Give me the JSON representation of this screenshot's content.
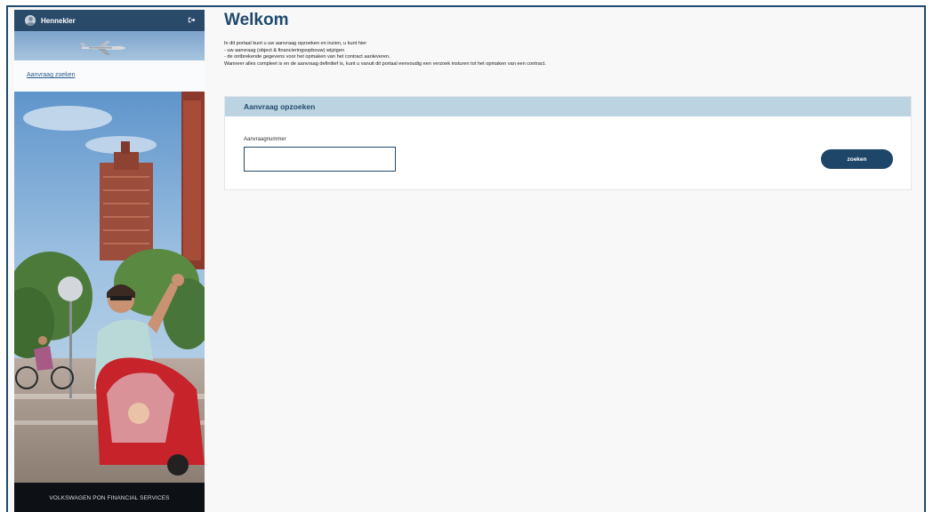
{
  "sidebar": {
    "username": "Hennekler",
    "nav": {
      "search_link": "Aanvraag zoeken"
    },
    "footer": "VOLKSWAGEN PON FINANCIAL SERVICES"
  },
  "main": {
    "title": "Welkom",
    "intro_lines": [
      "In dit portaal kunt u uw aanvraag opzoeken en inzien, u kunt hier",
      "- uw aanvraag (object & financieringsopbouw) wijzigen",
      "- de ontbrekende gegevens voor het opmaken van het contract aanleveren.",
      "Wanneer alles compleet is en de aanvraag definitief is, kunt u vanuit dit portaal eenvoudig een verzoek insturen tot het opmaken van een contract."
    ],
    "search_card": {
      "title": "Aanvraag opzoeken",
      "field_label": "Aanvraagnummer",
      "field_value": "",
      "button_label": "zoeken"
    }
  },
  "colors": {
    "brand": "#1f4a6b",
    "card_header": "#bcd4e2",
    "button": "#1e4668",
    "footer": "#0d1116"
  },
  "icons": [
    "user-avatar-icon",
    "logout-icon",
    "airplane-icon"
  ]
}
